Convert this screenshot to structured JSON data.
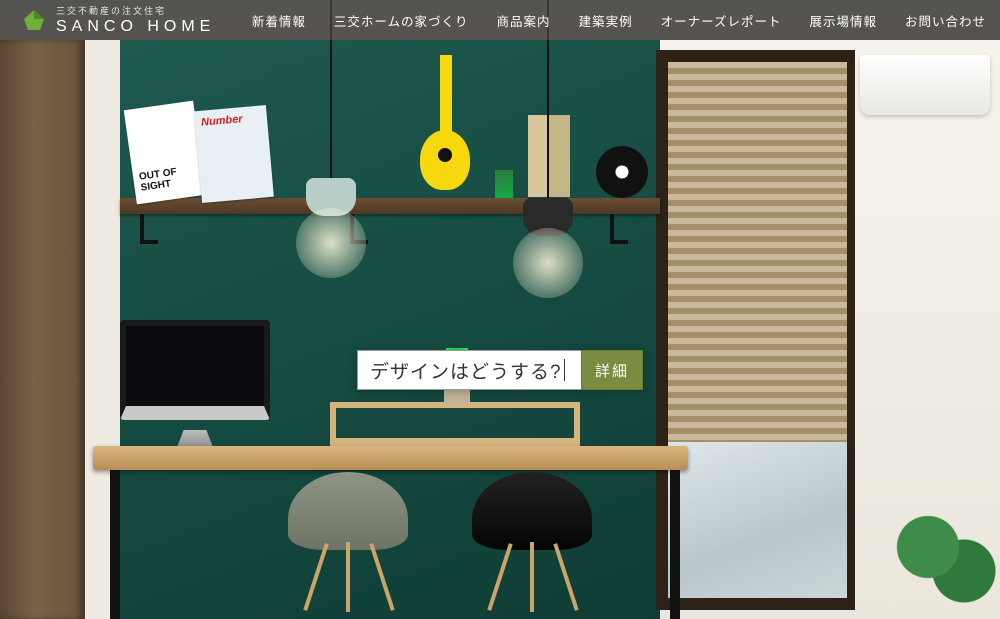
{
  "brand": {
    "tagline": "三交不動産の注文住宅",
    "name": "SANCO HOME"
  },
  "nav": {
    "items": [
      "新着情報",
      "三交ホームの家づくり",
      "商品案内",
      "建築実例",
      "オーナーズレポート",
      "展示場情報",
      "お問い合わせ"
    ]
  },
  "hero": {
    "query": "デザインはどうする?",
    "button": "詳細"
  },
  "colors": {
    "accent": "#7a8c3f",
    "wall": "#154a41"
  }
}
